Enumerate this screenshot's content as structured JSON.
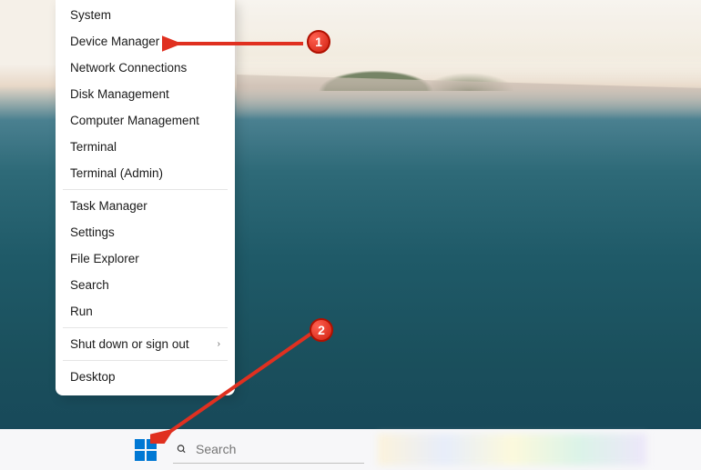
{
  "menu": {
    "items": [
      {
        "label": "System",
        "submenu": false
      },
      {
        "label": "Device Manager",
        "submenu": false
      },
      {
        "label": "Network Connections",
        "submenu": false
      },
      {
        "label": "Disk Management",
        "submenu": false
      },
      {
        "label": "Computer Management",
        "submenu": false
      },
      {
        "label": "Terminal",
        "submenu": false
      },
      {
        "label": "Terminal (Admin)",
        "submenu": false
      }
    ],
    "items2": [
      {
        "label": "Task Manager",
        "submenu": false
      },
      {
        "label": "Settings",
        "submenu": false
      },
      {
        "label": "File Explorer",
        "submenu": false
      },
      {
        "label": "Search",
        "submenu": false
      },
      {
        "label": "Run",
        "submenu": false
      }
    ],
    "items3": [
      {
        "label": "Shut down or sign out",
        "submenu": true
      }
    ],
    "items4": [
      {
        "label": "Desktop",
        "submenu": false
      }
    ]
  },
  "taskbar": {
    "search_placeholder": "Search"
  },
  "annotations": {
    "badge1": "1",
    "badge2": "2",
    "color": "#e03020"
  }
}
